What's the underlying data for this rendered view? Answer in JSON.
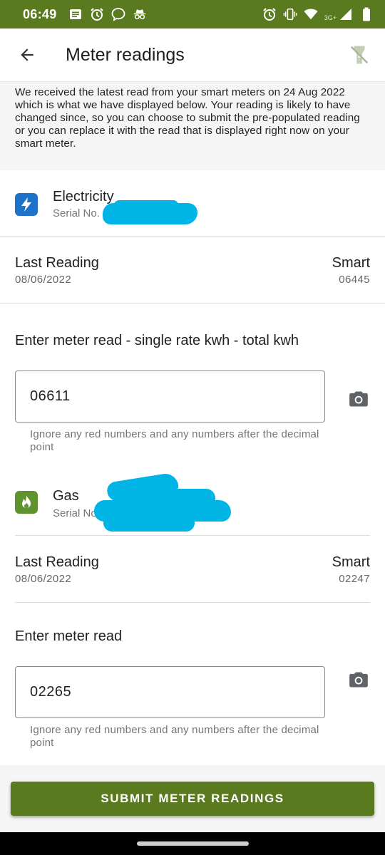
{
  "status_bar": {
    "time": "06:49",
    "network": "3G+",
    "left_icons": [
      "message-icon",
      "alarm-icon",
      "chat-bubble-icon",
      "incognito-icon"
    ],
    "right_icons": [
      "alarm-icon",
      "vibrate-icon",
      "wifi-icon",
      "cell-signal-icon",
      "battery-icon"
    ]
  },
  "app_bar": {
    "title": "Meter readings",
    "back_icon": "arrow-left-icon",
    "action_icon": "torch-off-icon"
  },
  "info_banner": {
    "text": "We received the latest read from your smart meters on 24 Aug 2022 which is what we have displayed below. Your reading is likely to have changed since, so you can choose to submit the pre-populated reading or you can replace it with the read that is displayed right now on your smart meter."
  },
  "electricity": {
    "type": "Electricity",
    "serial_label": "Serial No.",
    "badge_color": "#1e73c8",
    "last_reading_label": "Last Reading",
    "last_reading_date": "08/06/2022",
    "reading_type": "Smart",
    "last_reading_value": "06445",
    "enter_label": "Enter meter read - single rate kwh - total kwh",
    "input_value": "06611",
    "help_text": "Ignore any red numbers and any numbers after the decimal point"
  },
  "gas": {
    "type": "Gas",
    "serial_label": "Serial No.",
    "badge_color": "#5f9330",
    "last_reading_label": "Last Reading",
    "last_reading_date": "08/06/2022",
    "reading_type": "Smart",
    "last_reading_value": "02247",
    "enter_label": "Enter meter read",
    "input_value": "02265",
    "help_text": "Ignore any red numbers and any numbers after the decimal point"
  },
  "submit_button": {
    "label": "SUBMIT METER READINGS",
    "color": "#5a7a1f"
  },
  "redaction_color": "#00b4e6"
}
